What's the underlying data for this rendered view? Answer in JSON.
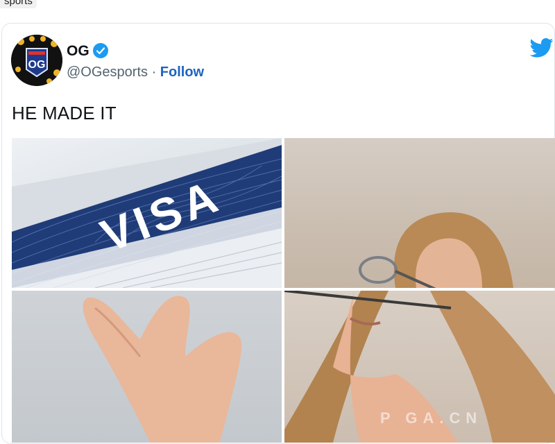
{
  "top_fragment": "sports",
  "tweet": {
    "display_name": "OG",
    "handle": "@OGesports",
    "separator": " · ",
    "follow_label": "Follow",
    "text": "HE MADE IT"
  },
  "media": {
    "tile_1": {
      "visa_text": "VISA"
    },
    "watermark": "P   GA.CN"
  },
  "colors": {
    "verified": "#1d9bf0",
    "follow_link": "#1d64c0",
    "twitter_brand": "#1d9bf0",
    "visa_blue": "#1f3c78"
  },
  "icons": {
    "verified": "verified-badge-icon",
    "brand": "twitter-bird-icon"
  }
}
